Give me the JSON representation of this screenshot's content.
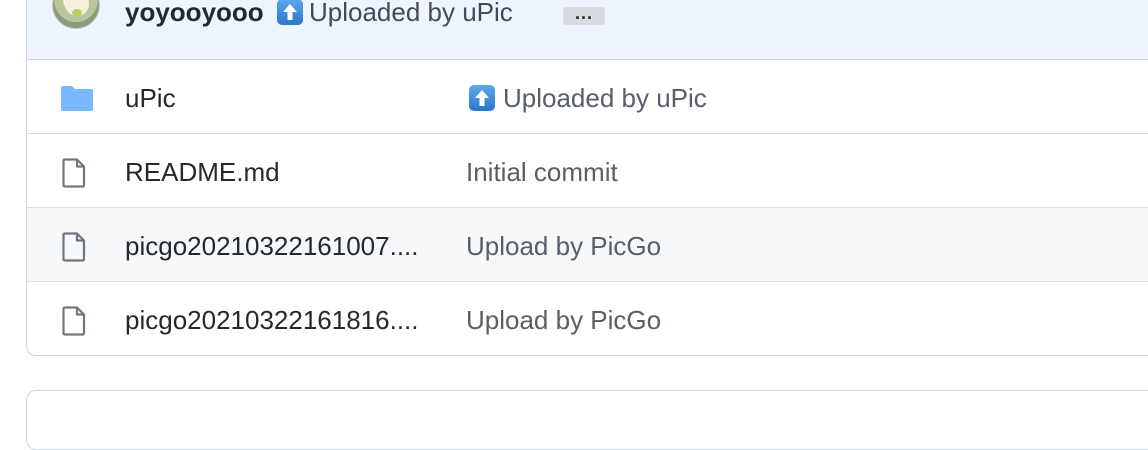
{
  "latest_commit": {
    "author": "yoyooyooo",
    "emoji": "arrow-up-emoji",
    "message": "Uploaded by uPic",
    "more_label": "..."
  },
  "files": [
    {
      "type": "folder",
      "icon": "folder-icon",
      "name": "uPic",
      "message": "Uploaded by uPic",
      "message_emoji": "arrow-up-emoji"
    },
    {
      "type": "file",
      "icon": "file-icon",
      "name": "README.md",
      "message": "Initial commit"
    },
    {
      "type": "file",
      "icon": "file-icon",
      "name": "picgo20210322161007....",
      "message": "Upload by PicGo"
    },
    {
      "type": "file",
      "icon": "file-icon",
      "name": "picgo20210322161816....",
      "message": "Upload by PicGo"
    }
  ],
  "colors": {
    "header_bg": "#eef5ff",
    "folder": "#79b8ff",
    "border": "#d0d7de",
    "alt_row": "#f6f8fa"
  }
}
